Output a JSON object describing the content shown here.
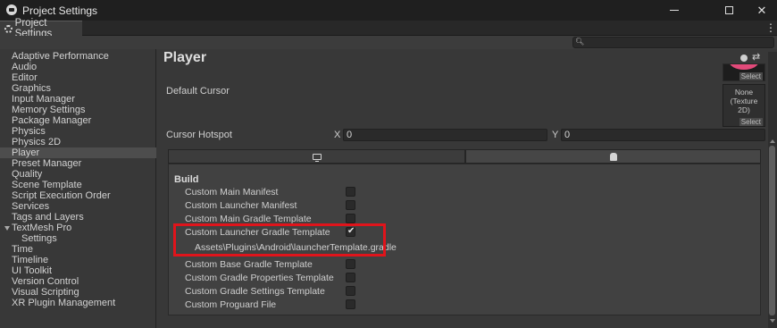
{
  "window": {
    "title": "Project Settings",
    "tab_label": "Project Settings",
    "menu_glyph": "⋮",
    "minimize_glyph": "—",
    "maximize_glyph": "□",
    "close_glyph": "✕"
  },
  "search": {
    "placeholder": "",
    "icon": "search-icon"
  },
  "sidebar": {
    "items": [
      {
        "label": "Adaptive Performance"
      },
      {
        "label": "Audio"
      },
      {
        "label": "Editor"
      },
      {
        "label": "Graphics"
      },
      {
        "label": "Input Manager"
      },
      {
        "label": "Memory Settings"
      },
      {
        "label": "Package Manager"
      },
      {
        "label": "Physics"
      },
      {
        "label": "Physics 2D"
      },
      {
        "label": "Player",
        "selected": true
      },
      {
        "label": "Preset Manager"
      },
      {
        "label": "Quality"
      },
      {
        "label": "Scene Template"
      },
      {
        "label": "Script Execution Order"
      },
      {
        "label": "Services"
      },
      {
        "label": "Tags and Layers"
      },
      {
        "label": "TextMesh Pro",
        "expanded": true
      },
      {
        "label": "Settings",
        "child": true
      },
      {
        "label": "Time"
      },
      {
        "label": "Timeline"
      },
      {
        "label": "UI Toolkit"
      },
      {
        "label": "Version Control"
      },
      {
        "label": "Visual Scripting"
      },
      {
        "label": "XR Plugin Management"
      }
    ]
  },
  "main": {
    "title": "Player",
    "icons": {
      "help": "help-icon",
      "preset": "preset-icon",
      "more": "more-icon"
    },
    "icon_select_label": "Select",
    "default_cursor": {
      "label": "Default Cursor",
      "value_line1": "None",
      "value_line2": "(Texture 2D)",
      "select_label": "Select"
    },
    "cursor_hotspot": {
      "label": "Cursor Hotspot",
      "x_label": "X",
      "x_value": "0",
      "y_label": "Y",
      "y_value": "0"
    },
    "platform_tabs": [
      {
        "name": "standalone",
        "icon": "monitor-icon",
        "active": false
      },
      {
        "name": "android",
        "icon": "android-icon",
        "active": true
      }
    ],
    "build": {
      "heading": "Build",
      "options": [
        {
          "label": "Custom Main Manifest",
          "checked": false
        },
        {
          "label": "Custom Launcher Manifest",
          "checked": false
        },
        {
          "label": "Custom Main Gradle Template",
          "checked": false
        },
        {
          "label": "Custom Launcher Gradle Template",
          "checked": true
        },
        {
          "label": "Custom Base Gradle Template",
          "checked": false
        },
        {
          "label": "Custom Gradle Properties Template",
          "checked": false
        },
        {
          "label": "Custom Gradle Settings Template",
          "checked": false
        },
        {
          "label": "Custom Proguard File",
          "checked": false
        }
      ],
      "launcher_template_path": "Assets\\Plugins\\Android\\launcherTemplate.gradle"
    }
  },
  "colors": {
    "highlight": "#e0141b",
    "background": "#383838",
    "selected_item": "#4d4d4d"
  }
}
